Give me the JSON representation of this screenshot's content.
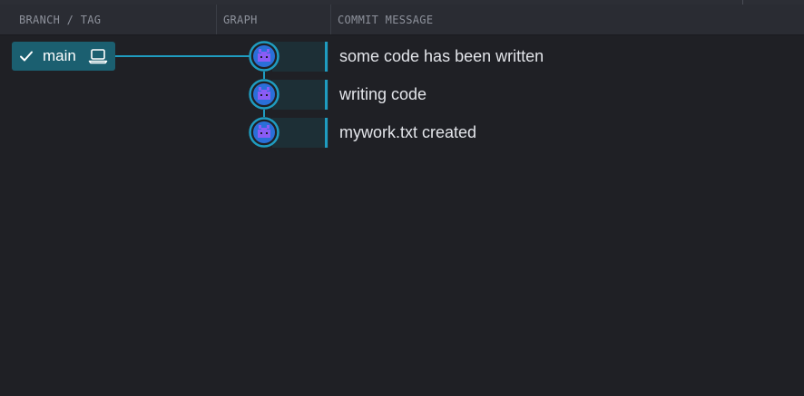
{
  "columns": {
    "branch_tag": "BRANCH / TAG",
    "graph": "GRAPH",
    "commit_message": "COMMIT MESSAGE"
  },
  "branch": {
    "name": "main",
    "is_current": true,
    "checked_out_locally": true
  },
  "commits": [
    {
      "message": "some code has been written"
    },
    {
      "message": "writing code"
    },
    {
      "message": "mywork.txt created"
    }
  ],
  "colors": {
    "background": "#1f2025",
    "header": "#2a2c33",
    "branch_pill": "#1b5f70",
    "graph_line": "#1f9cc0",
    "avatar": "#8a5cf5"
  },
  "icons": {
    "check": "check-icon",
    "laptop": "laptop-icon",
    "avatar": "author-avatar-icon"
  }
}
